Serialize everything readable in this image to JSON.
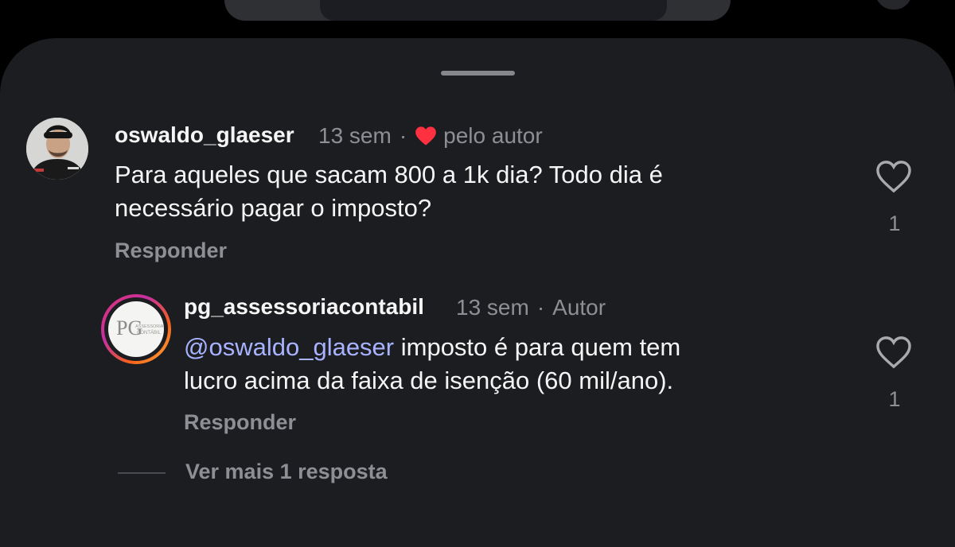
{
  "comments": [
    {
      "username": "oswaldo_glaeser",
      "time": "13 sem",
      "separator": "·",
      "liked_by_author_label": "pelo autor",
      "text_line1": "Para aqueles que sacam 800 a 1k dia? Todo dia é",
      "text_line2": "necessário pagar o imposto?",
      "reply_label": "Responder",
      "like_count": "1"
    }
  ],
  "replies": [
    {
      "username": "pg_assessoriacontabil",
      "time": "13 sem",
      "separator": "·",
      "author_badge": "Autor",
      "mention": "@oswaldo_glaeser",
      "text_line1_rest": " imposto é para quem tem",
      "text_line2": "lucro acima da faixa de isenção (60 mil/ano).",
      "reply_label": "Responder",
      "like_count": "1",
      "logo_letters": "PG",
      "logo_text_top": "ASSESSORIA",
      "logo_text_bottom": "CONTÁBIL"
    }
  ],
  "view_more_label": "Ver mais 1 resposta",
  "colors": {
    "sheet_bg": "#1c1d21",
    "primary_text": "#f5f5f5",
    "secondary_text": "#8e8f94",
    "mention": "#a8b3ff",
    "heart_red": "#ff3040"
  }
}
